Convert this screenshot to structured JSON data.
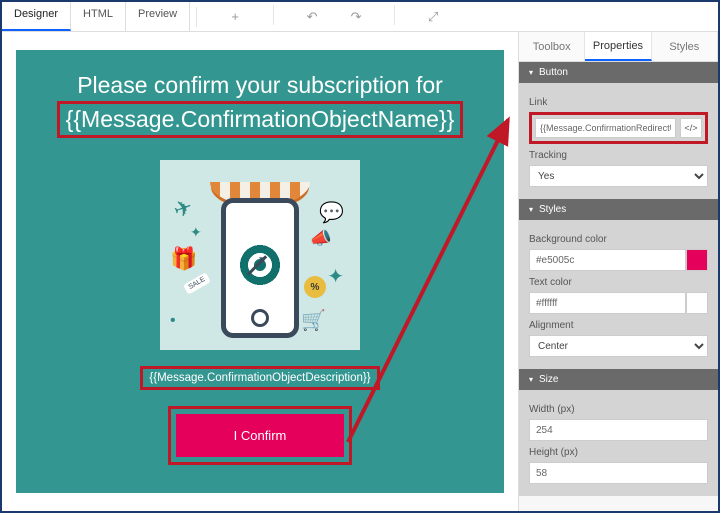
{
  "topbar": {
    "tabs": {
      "designer": "Designer",
      "html": "HTML",
      "preview": "Preview"
    }
  },
  "canvas": {
    "headline": "Please confirm your subscription for",
    "macro_main": "{{Message.ConfirmationObjectName}}",
    "macro_desc": "{{Message.ConfirmationObjectDescription}}",
    "confirm_label": "I Confirm",
    "sale_tag": "SALE"
  },
  "sidepanel": {
    "tabs": {
      "toolbox": "Toolbox",
      "properties": "Properties",
      "styles": "Styles"
    },
    "sections": {
      "button": {
        "title": "Button",
        "link_label": "Link",
        "link_value": "{{Message.ConfirmationRedirectURL}}",
        "tracking_label": "Tracking",
        "tracking_value": "Yes"
      },
      "styles": {
        "title": "Styles",
        "bg_label": "Background color",
        "bg_value": "#e5005c",
        "text_label": "Text color",
        "text_value": "#ffffff",
        "align_label": "Alignment",
        "align_value": "Center"
      },
      "size": {
        "title": "Size",
        "width_label": "Width (px)",
        "width_value": "254",
        "height_label": "Height (px)",
        "height_value": "58"
      }
    }
  }
}
